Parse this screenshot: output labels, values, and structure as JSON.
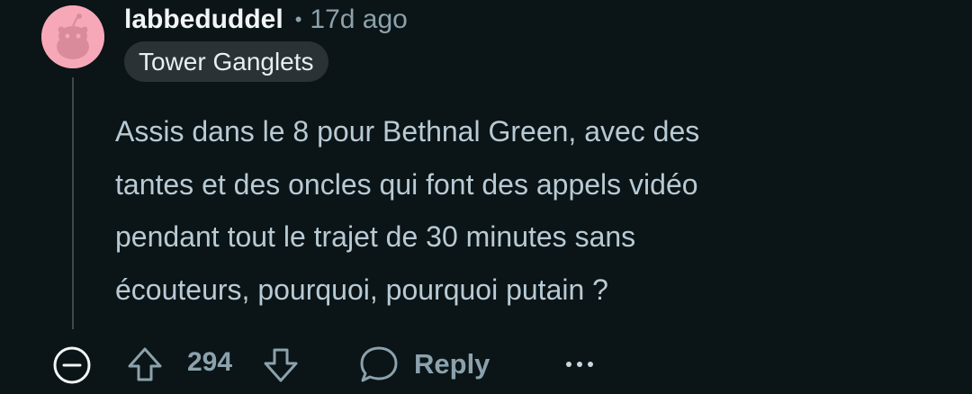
{
  "comment": {
    "username": "labbeduddel",
    "separator": "•",
    "time_ago": "17d ago",
    "flair": "Tower Ganglets",
    "body_lines": [
      "Assis dans le 8 pour Bethnal Green, avec des",
      "tantes et des oncles qui font des appels vidéo",
      "pendant tout le trajet de 30 minutes sans",
      "écouteurs, pourquoi, pourquoi putain ?"
    ]
  },
  "actions": {
    "score": "294",
    "reply_label": "Reply"
  },
  "icons": {
    "avatar": "reddit-snoo-avatar",
    "collapse": "collapse-minus-icon",
    "upvote": "upvote-arrow-icon",
    "downvote": "downvote-arrow-icon",
    "reply": "speech-bubble-icon",
    "more": "more-options-icon"
  },
  "colors": {
    "background": "#0b1416",
    "username": "#f2f5f6",
    "meta": "#8ba2ad",
    "body": "#b8cad4",
    "flair_bg": "#2a3236",
    "avatar_bg": "#f7a8b8"
  }
}
